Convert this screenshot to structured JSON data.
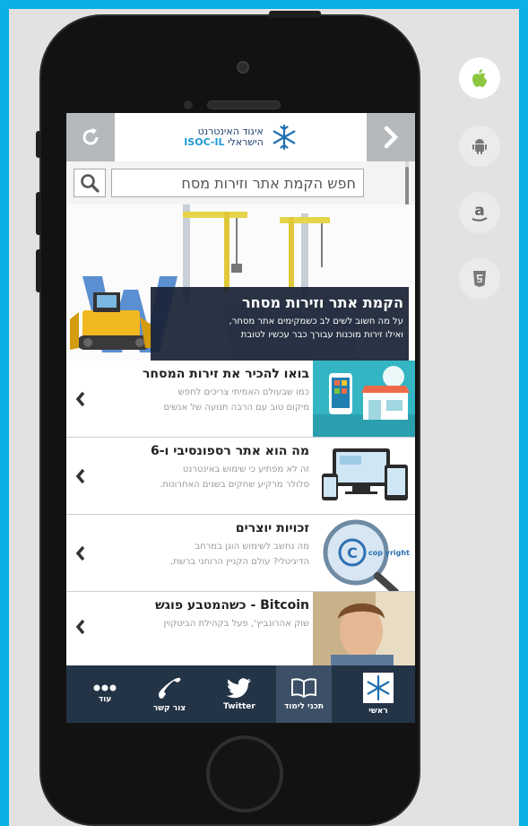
{
  "header": {
    "logo_line1": "איגוד האינטרנט",
    "logo_line2_prefix": "הישראלי",
    "logo_line2_brand": "ISOC-IL"
  },
  "search": {
    "placeholder": "חפש הקמת אתר וזירות מסח"
  },
  "hero": {
    "title": "הקמת אתר וזירות מסחר",
    "desc_line1": "על מה חשוב לשים לב כשמקימים אתר מסחר,",
    "desc_line2": "ואילו זירות מוכנות עבורך כבר עכשיו לטובת"
  },
  "articles": [
    {
      "title": "בואו להכיר את זירות המסחר",
      "desc_line1": "כמו שבעולם האמיתי צריכים לחפש",
      "desc_line2": "מיקום טוב עם הרבה תנועה של אנשים"
    },
    {
      "title": "מה הוא אתר רספונסיבי ו-6",
      "desc_line1": "זה לא מפתיע כי שימוש באינטרנט",
      "desc_line2": "סלולר מרקיע שחקים בשנים האחרונות."
    },
    {
      "title": "זכויות יוצרים",
      "desc_line1": "מה נחשב לשימוש הוגן במרחב",
      "desc_line2": "הדיגיטלי? עולם הקניין הרוחני ברשת,",
      "thumb_text": "cop yright"
    },
    {
      "title": "Bitcoin - כשהמטבע פוגש",
      "desc_line1": "שוק אהרונביץ', פעל בקהילת הביטקוין"
    }
  ],
  "tabs": [
    {
      "label": "עוד",
      "icon": "more-icon"
    },
    {
      "label": "צור קשר",
      "icon": "phone-icon"
    },
    {
      "label": "Twitter",
      "icon": "twitter-icon"
    },
    {
      "label": "תכני לימוד",
      "icon": "book-icon"
    },
    {
      "label": "ראשי",
      "icon": "home-logo-icon"
    }
  ],
  "stores": [
    "apple-icon",
    "android-icon",
    "amazon-icon",
    "html5-icon"
  ],
  "colors": {
    "page_border": "#0ab0e8",
    "tabbar": "#243447",
    "apple_green": "#8cc63f"
  }
}
